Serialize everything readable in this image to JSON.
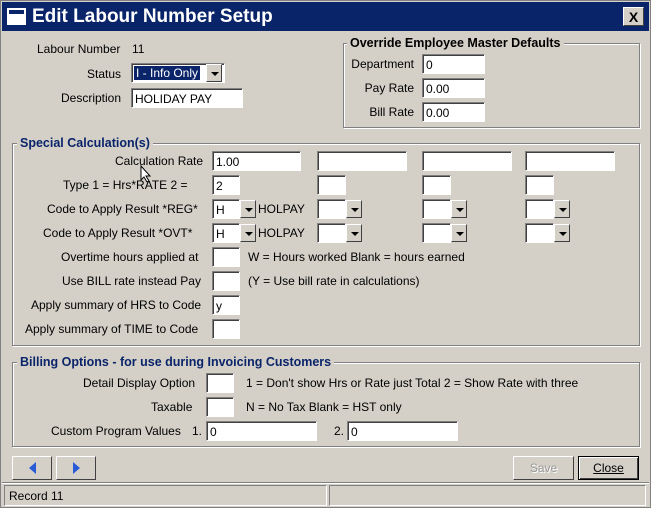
{
  "window": {
    "title": "Edit Labour Number Setup",
    "close_glyph": "X"
  },
  "header": {
    "labour_number_label": "Labour Number",
    "labour_number_value": "11",
    "status_label": "Status",
    "status_value": "I - Info Only",
    "description_label": "Description",
    "description_value": "HOLIDAY PAY"
  },
  "override": {
    "title": "Override Employee Master Defaults",
    "department_label": "Department",
    "department_value": "0",
    "pay_rate_label": "Pay Rate",
    "pay_rate_value": "0.00",
    "bill_rate_label": "Bill Rate",
    "bill_rate_value": "0.00"
  },
  "special": {
    "title": "Special Calculation(s)",
    "calc_rate_label": "Calculation Rate",
    "calc_rate_values": [
      "1.00",
      "",
      "",
      ""
    ],
    "type_label": "Type 1 = Hrs*RATE  2 =",
    "type_values": [
      "2",
      "",
      "",
      ""
    ],
    "code_reg_label": "Code to Apply Result *REG*",
    "code_reg_values": [
      "H",
      "",
      "",
      ""
    ],
    "code_reg_desc": "HOLPAY",
    "code_ovt_label": "Code to Apply Result *OVT*",
    "code_ovt_values": [
      "H",
      "",
      "",
      ""
    ],
    "code_ovt_desc": "HOLPAY",
    "overtime_label": "Overtime hours applied at",
    "overtime_value": "",
    "overtime_hint": "W = Hours worked   Blank = hours earned",
    "bill_rate_label": "Use BILL rate instead Pay",
    "bill_rate_value": "",
    "bill_rate_hint": "(Y = Use bill rate in calculations)",
    "summary_hrs_label": "Apply summary of HRS to Code",
    "summary_hrs_value": "y",
    "summary_time_label": "Apply summary of TIME to Code",
    "summary_time_value": ""
  },
  "billing": {
    "title": "Billing Options - for use during Invoicing Customers",
    "detail_label": "Detail Display Option",
    "detail_value": "",
    "detail_hint": "1 = Don't show Hrs or Rate just Total   2 = Show Rate with three",
    "taxable_label": "Taxable",
    "taxable_value": "",
    "taxable_hint": "N = No Tax   Blank = HST only",
    "custom_label": "Custom Program Values",
    "custom_1_label": "1.",
    "custom_1_value": "0",
    "custom_2_label": "2.",
    "custom_2_value": "0"
  },
  "buttons": {
    "save": "Save",
    "close": "Close"
  },
  "statusbar": {
    "record": "Record 11",
    "pane2": ""
  }
}
